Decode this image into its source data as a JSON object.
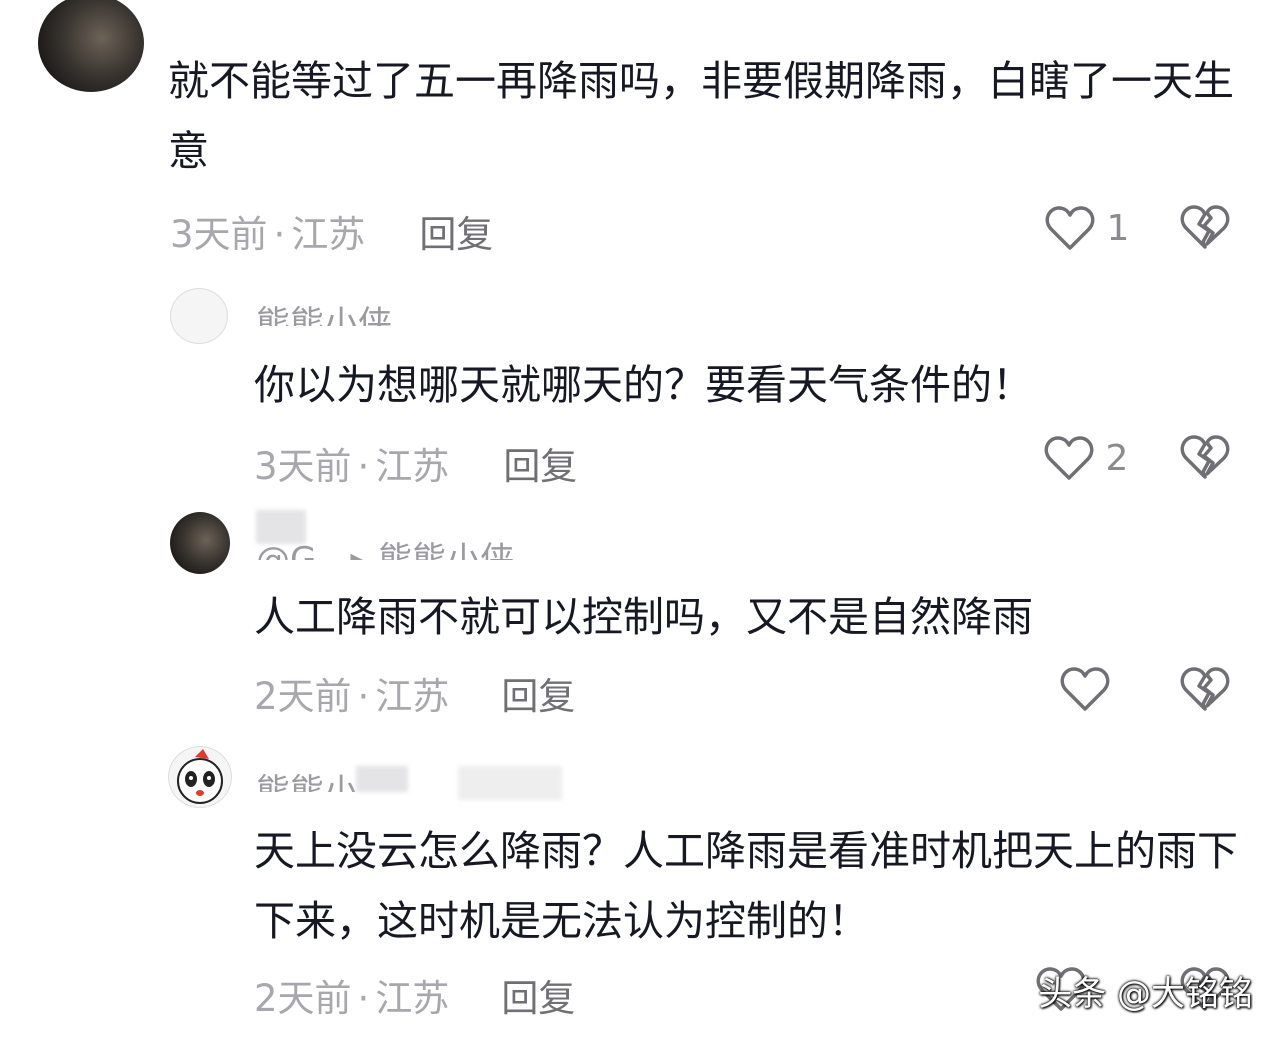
{
  "comments": [
    {
      "username": "",
      "text": "就不能等过了五一再降雨吗，非要假期降雨，白瞎了一天生意",
      "time": "3天前",
      "location": "江苏",
      "reply_label": "回复",
      "likes": "1"
    },
    {
      "username": "熊熊小侠",
      "text": "你以为想哪天就哪天的？要看天气条件的！",
      "time": "3天前",
      "location": "江苏",
      "reply_label": "回复",
      "likes": "2"
    },
    {
      "username": "@G。▸ 熊熊小侠",
      "text": "人工降雨不就可以控制吗，又不是自然降雨",
      "time": "2天前",
      "location": "江苏",
      "reply_label": "回复",
      "likes": ""
    },
    {
      "username": "熊熊小",
      "text": "天上没云怎么降雨？人工降雨是看准时机把天上的雨下下来，这时机是无法认为控制的！",
      "time": "2天前",
      "location": "江苏",
      "reply_label": "回复",
      "likes": ""
    }
  ],
  "separator": "·",
  "watermark": "头条 @大铭铭",
  "icons": {
    "like": "heart-outline-icon",
    "dislike": "broken-heart-icon"
  },
  "colors": {
    "text": "#161823",
    "meta": "#a7a7ad",
    "icon": "#6f6f75"
  }
}
